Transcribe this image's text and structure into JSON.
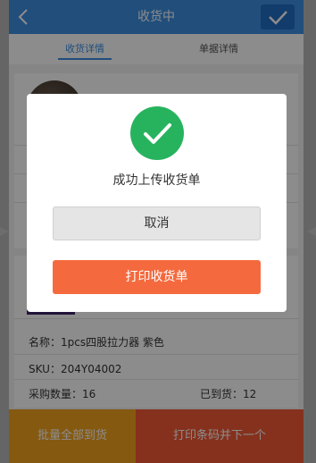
{
  "header": {
    "title": "收货中",
    "back_icon": "chevron-left-icon",
    "confirm_icon": "check-icon"
  },
  "tabs": [
    {
      "label": "收货详情",
      "active": true
    },
    {
      "label": "单据详情",
      "active": false
    }
  ],
  "product": {
    "name_label": "名称：",
    "name": "1pcs四股拉力器 紫色",
    "sku_label": "SKU：",
    "sku": "204Y04002",
    "purchase_qty_label": "采购数量：",
    "purchase_qty": "16",
    "arrived_label": "已到货：",
    "arrived": "12"
  },
  "bottom_bar": {
    "batch_label": "批量全部到货",
    "print_next_label": "打印条码并下一个"
  },
  "dialog": {
    "icon": "success-check-icon",
    "message": "成功上传收货单",
    "cancel_label": "取消",
    "print_label": "打印收货单"
  },
  "colors": {
    "header": "#3c8fe0",
    "success": "#27b35e",
    "print_button": "#f46a3e",
    "batch_button": "#f3a31e",
    "print_next_button": "#f25a35"
  }
}
